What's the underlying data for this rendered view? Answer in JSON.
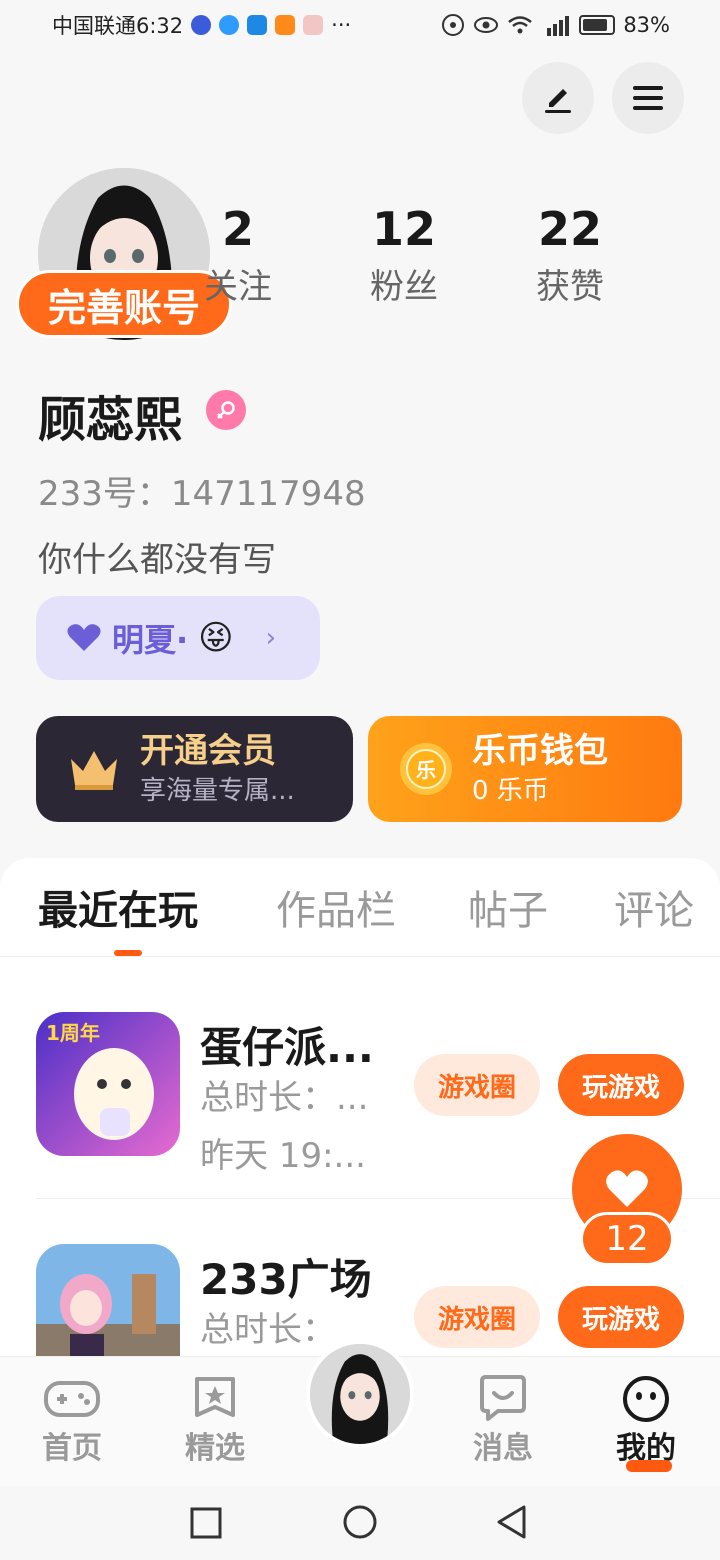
{
  "status_bar": {
    "carrier_time": "中国联通6:32",
    "more": "···",
    "battery": "83%"
  },
  "profile": {
    "complete_badge": "完善账号",
    "stats": [
      {
        "num": "2",
        "label": "关注"
      },
      {
        "num": "12",
        "label": "粉丝"
      },
      {
        "num": "22",
        "label": "获赞"
      }
    ],
    "username": "顾蕊熙",
    "uid": "233号：147117948",
    "bio": "你什么都没有写",
    "tag": {
      "text": "明夏·",
      "emoji": "😝"
    }
  },
  "cards": {
    "vip": {
      "title": "开通会员",
      "sub": "享海量专属..."
    },
    "coins": {
      "title": "乐币钱包",
      "sub": "0 乐币",
      "coin_glyph": "乐"
    }
  },
  "tabs": [
    "最近在玩",
    "作品栏",
    "帖子",
    "评论"
  ],
  "games": [
    {
      "title": "蛋仔派...",
      "duration": "总时长：...",
      "last_played": "昨天 19:...",
      "icon_label": "1周年",
      "btn_circle": "游戏圈",
      "btn_play": "玩游戏"
    },
    {
      "title": "233广场",
      "duration": "总时长：",
      "btn_circle": "游戏圈",
      "btn_play": "玩游戏"
    }
  ],
  "like_count": "12",
  "bottom_nav": [
    "首页",
    "精选",
    "消息",
    "我的"
  ],
  "colors": {
    "accent": "#ff6a1a",
    "vip_bg": "#2b2735",
    "tag_bg": "#e4e2fa"
  }
}
